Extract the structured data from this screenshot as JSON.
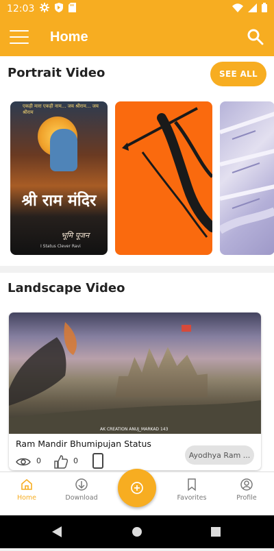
{
  "status_bar": {
    "time": "12:03",
    "icons": [
      "settings-icon",
      "play-protect-icon",
      "sd-card-icon",
      "wifi-icon",
      "cellular-icon",
      "battery-icon"
    ]
  },
  "app_bar": {
    "title": "Home",
    "menu_icon": "hamburger-menu-icon",
    "search_icon": "search-icon"
  },
  "portrait": {
    "title": "Portrait Video",
    "see_all": "SEE ALL",
    "items": [
      {
        "title": "श्री राम मंदिर",
        "subtitle": "भूमि पूजन",
        "top_text": "एकही मारा एकही नाम... जय श्रीराम... जय श्रीराम",
        "credit": "I Status Clever Ravi"
      },
      {
        "title": ""
      },
      {
        "title": ""
      }
    ]
  },
  "landscape": {
    "title": "Landscape Video",
    "items": [
      {
        "title": "Ram Mandir Bhumipujan Status",
        "views": "0",
        "likes": "0",
        "category": "Ayodhya Ram ...",
        "watermark": "AK CREATION   ANUJ_MARKAD 143"
      }
    ]
  },
  "bottom_nav": {
    "items": [
      {
        "label": "Home",
        "icon": "home-icon",
        "active": true
      },
      {
        "label": "Download",
        "icon": "download-icon",
        "active": false
      },
      {
        "label": "",
        "icon": "add-circle-icon",
        "active": false
      },
      {
        "label": "Favorites",
        "icon": "bookmark-icon",
        "active": false
      },
      {
        "label": "Profile",
        "icon": "profile-icon",
        "active": false
      }
    ]
  },
  "colors": {
    "accent": "#f7ad21",
    "active_nav": "#f7ad21"
  }
}
